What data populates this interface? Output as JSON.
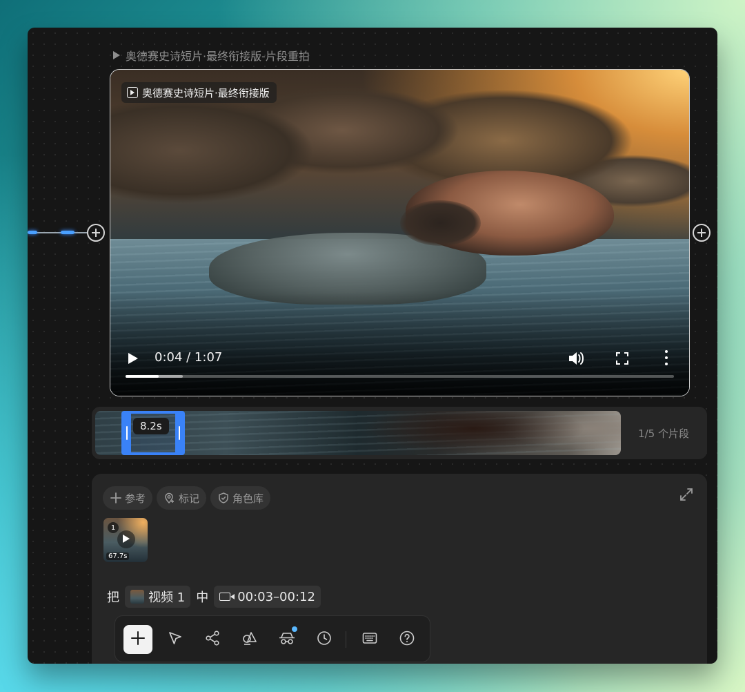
{
  "breadcrumb": {
    "title": "奥德赛史诗短片·最终衔接版-片段重拍"
  },
  "player": {
    "tag_label": "奥德赛史诗短片·最终衔接版",
    "time_text": "0:04 / 1:07",
    "progress_fraction": 0.06,
    "buffered_fraction": 0.104,
    "icons": [
      "play-icon",
      "volume-icon",
      "fullscreen-icon",
      "more-vertical-icon"
    ]
  },
  "timeline": {
    "clip_duration": "8.2s",
    "clip_count": "1/5 个片段",
    "accent": "#3a82f7"
  },
  "editor": {
    "chips": [
      {
        "label": "参考",
        "icon": "plus-icon"
      },
      {
        "label": "标记",
        "icon": "map-pin-icon"
      },
      {
        "label": "角色库",
        "icon": "shield-icon"
      }
    ],
    "thumbnail": {
      "index": "1",
      "duration": "67.7s"
    },
    "prompt": {
      "prefix": "把",
      "video_chip": "视频 1",
      "middle": "中",
      "time_range": "00:03–00:12"
    }
  },
  "toolbar": {
    "tools": [
      "add-icon",
      "pointer-icon",
      "share-nodes-icon",
      "shapes-icon",
      "incognito-icon",
      "clock-icon",
      "keyboard-icon",
      "help-icon"
    ]
  }
}
